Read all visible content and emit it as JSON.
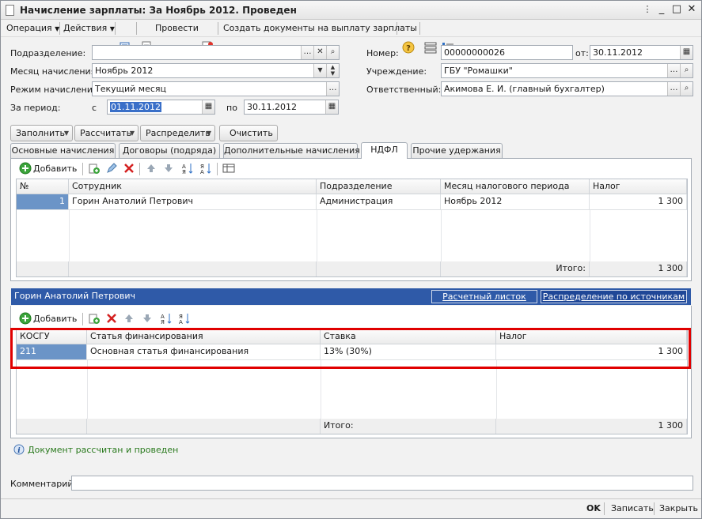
{
  "window": {
    "title": "Начисление зарплаты: За Ноябрь 2012. Проведен",
    "controls": {
      "more": "⋮",
      "minimize": "_",
      "maximize": "□",
      "close": "✕"
    }
  },
  "toolbar": {
    "operation": "Операция",
    "actions": "Действия",
    "post": "Провести",
    "create_docs": "Создать документы на выплату зарплаты"
  },
  "form": {
    "subdivision_label": "Подразделение:",
    "subdivision_value": "",
    "month_label": "Месяц начисления:",
    "month_value": "Ноябрь 2012",
    "mode_label": "Режим начисления:",
    "mode_value": "Текущий месяц",
    "period_label": "За период:",
    "period_from_label": "с",
    "period_from": "01.11.2012",
    "period_to_label": "по",
    "period_to": "30.11.2012",
    "number_label": "Номер:",
    "number_value": "00000000026",
    "date_label": "от:",
    "date_value": "30.11.2012",
    "institution_label": "Учреждение:",
    "institution_value": "ГБУ \"Ромашки\"",
    "responsible_label": "Ответственный:",
    "responsible_value": "Акимова Е. И. (главный бухгалтер)"
  },
  "actions_row": {
    "fill": "Заполнить",
    "calculate": "Рассчитать",
    "distribute": "Распределить",
    "clear": "Очистить"
  },
  "tabs": [
    {
      "label": "Основные начисления"
    },
    {
      "label": "Договоры (подряда)"
    },
    {
      "label": "Дополнительные начисления"
    },
    {
      "label": "НДФЛ"
    },
    {
      "label": "Прочие удержания"
    }
  ],
  "grid1": {
    "add_label": "Добавить",
    "columns": [
      "№",
      "Сотрудник",
      "Подразделение",
      "Месяц налогового периода",
      "Налог"
    ],
    "rows": [
      {
        "num": "1",
        "employee": "Горин Анатолий Петрович",
        "subdivision": "Администрация",
        "month": "Ноябрь 2012",
        "tax": "1 300"
      }
    ],
    "total_label": "Итого:",
    "total_value": "1 300"
  },
  "detail": {
    "employee": "Горин Анатолий Петрович",
    "payslip_link": "Расчетный листок",
    "sources_link": "Распределение по источникам"
  },
  "grid2": {
    "add_label": "Добавить",
    "columns": [
      "КОСГУ",
      "Статья финансирования",
      "Ставка",
      "Налог"
    ],
    "rows": [
      {
        "kosgu": "211",
        "article": "Основная статья финансирования",
        "rate": "13% (30%)",
        "tax": "1 300"
      }
    ],
    "total_label": "Итого:",
    "total_value": "1 300"
  },
  "status": "Документ рассчитан и проведен",
  "comment_label": "Комментарий:",
  "comment_value": "",
  "bottom": {
    "ok": "OK",
    "save": "Записать",
    "close": "Закрыть"
  }
}
